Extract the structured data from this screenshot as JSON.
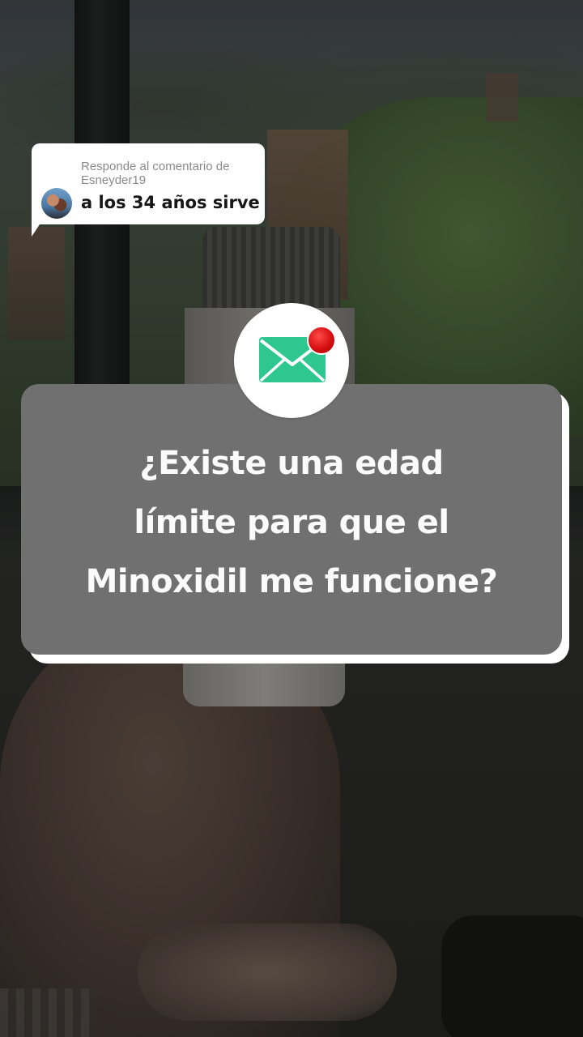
{
  "comment": {
    "reply_prefix": "Responde al comentario de Esneyder19",
    "text": "a los 34 años sirve"
  },
  "card": {
    "line1": "¿Existe una edad",
    "line2": "límite para que el",
    "line3": "Minoxidil me funcione?"
  },
  "icons": {
    "mail": "envelope-icon",
    "notification": "red-dot-badge"
  },
  "colors": {
    "card_background": "#707070",
    "card_border": "#ffffff",
    "envelope": "#2ec78f",
    "badge": "#d60f0f"
  }
}
